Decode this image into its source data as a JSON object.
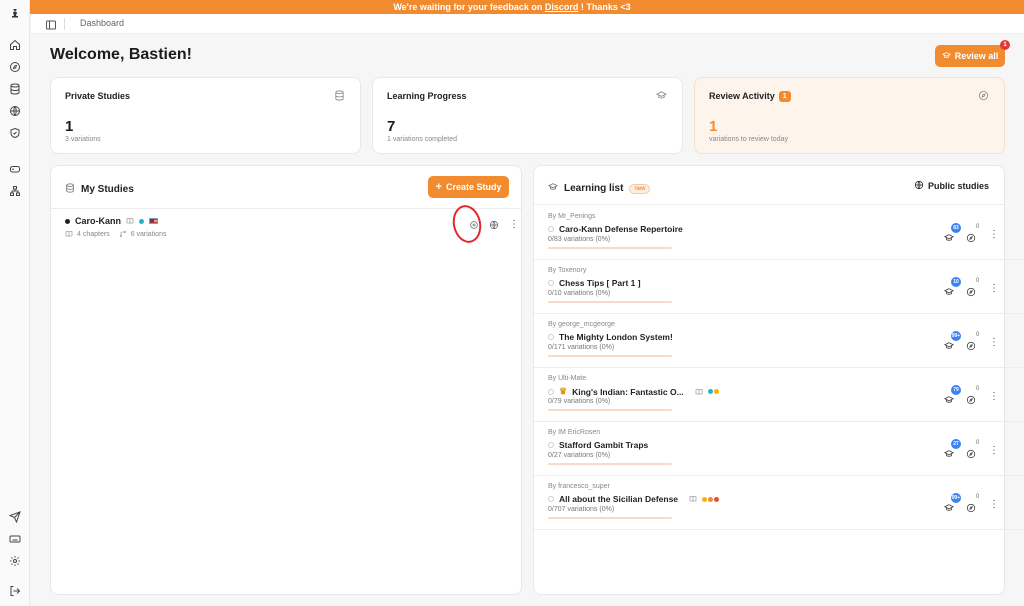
{
  "banner": {
    "text_before": "We're waiting for your feedback on ",
    "link": "Discord",
    "text_after": " ! Thanks <3"
  },
  "topbar": {
    "breadcrumb": "Dashboard"
  },
  "header": {
    "welcome": "Welcome, Bastien!",
    "review_all_label": "Review all",
    "review_all_badge": "1"
  },
  "stats": {
    "private": {
      "title": "Private Studies",
      "value": "1",
      "sub": "3 variations"
    },
    "progress": {
      "title": "Learning Progress",
      "value": "7",
      "sub": "1 variations completed"
    },
    "review": {
      "title": "Review Activity",
      "badge": "1",
      "value": "1",
      "sub": "variations to review today"
    }
  },
  "my_studies": {
    "title": "My Studies",
    "create_label": "Create Study",
    "items": [
      {
        "name": "Caro-Kann",
        "chapters": "4 chapters",
        "variations": "6 variations"
      }
    ]
  },
  "learning_list": {
    "title": "Learning list",
    "new_badge": "new",
    "public_label": "Public studies",
    "items": [
      {
        "author": "By Mr_Penings",
        "title": "Caro-Kann Defense Repertoire",
        "sub": "0/83 variations (0%)",
        "count": "83",
        "zero": "0"
      },
      {
        "author": "By Toxenory",
        "title": "Chess Tips [ Part 1 ]",
        "sub": "0/10 variations (0%)",
        "count": "10",
        "zero": "0"
      },
      {
        "author": "By george_mcgeorge",
        "title": "The Mighty London System!",
        "sub": "0/171 variations (0%)",
        "count": "99+",
        "zero": "0"
      },
      {
        "author": "By Ulti-Mate",
        "title": "King's Indian: Fantastic O...",
        "sub": "0/79 variations (0%)",
        "count": "79",
        "zero": "0"
      },
      {
        "author": "By IM EricRosen",
        "title": "Stafford Gambit Traps",
        "sub": "0/27 variations (0%)",
        "count": "27",
        "zero": "0"
      },
      {
        "author": "By francesco_super",
        "title": "All about the Sicilian Defense",
        "sub": "0/707 variations (0%)",
        "count": "99+",
        "zero": "0"
      }
    ]
  },
  "colors": {
    "accent": "#f28b2e",
    "badge_blue": "#3b82f6",
    "annotation_red": "#e0282e"
  },
  "icons": [
    "chess-piece-icon",
    "home-icon",
    "compass-icon",
    "database-icon",
    "globe-icon",
    "shield-icon",
    "gamepad-icon",
    "sitemap-icon",
    "send-icon",
    "keyboard-icon",
    "gear-icon",
    "logout-icon",
    "sidebar-toggle-icon",
    "graduation-cap-icon"
  ]
}
